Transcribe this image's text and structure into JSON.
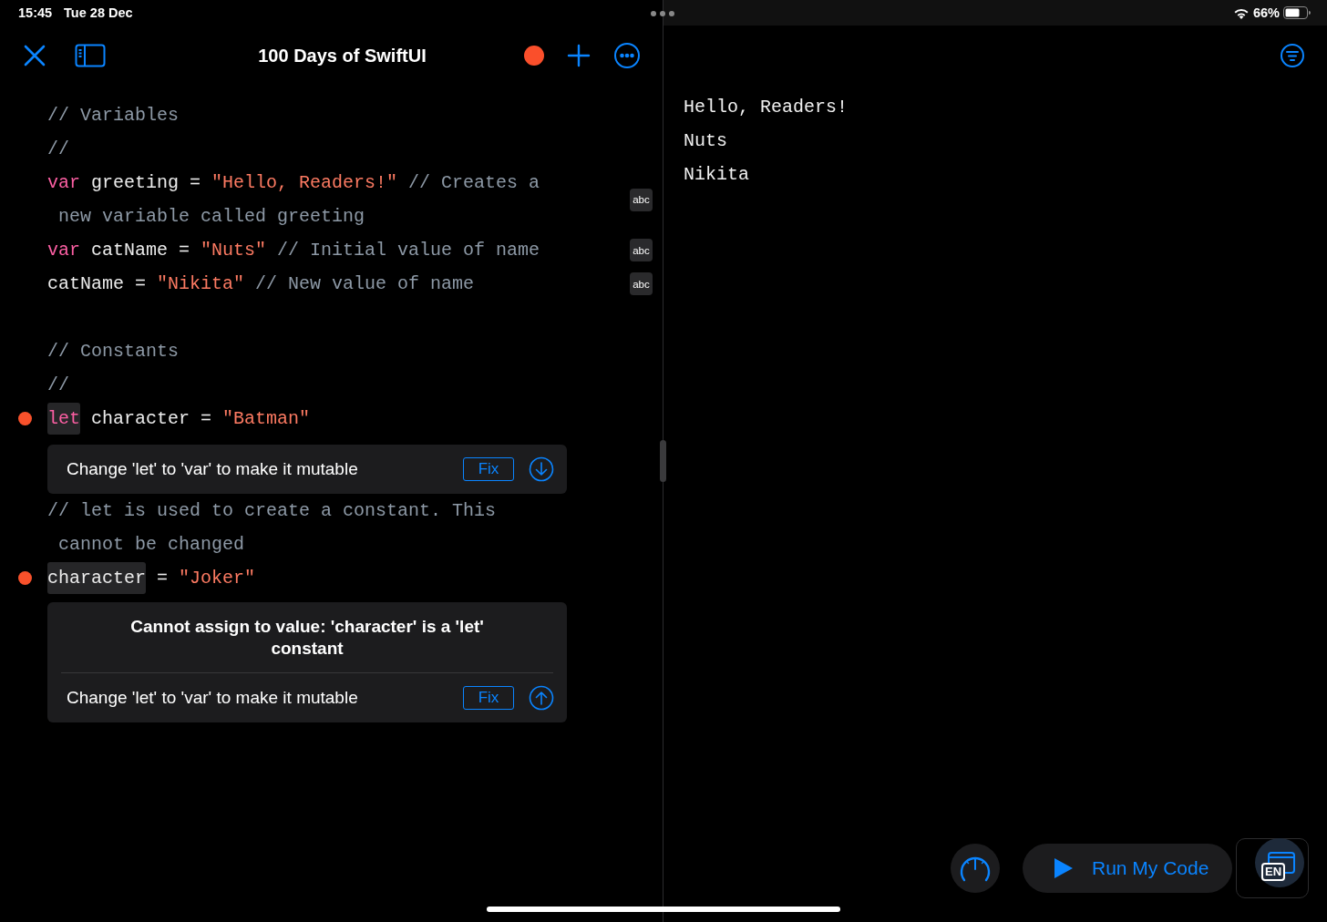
{
  "status_bar": {
    "time": "15:45",
    "date": "Tue 28 Dec",
    "battery": "66%"
  },
  "toolbar": {
    "title": "100 Days of SwiftUI",
    "recording": true
  },
  "code": [
    {
      "kind": "statement",
      "error": false,
      "lines": [
        [
          {
            "kind": "comment",
            "text": "// Variables"
          }
        ]
      ]
    },
    {
      "kind": "statement",
      "error": false,
      "lines": [
        [
          {
            "kind": "comment",
            "text": "//"
          }
        ]
      ]
    },
    {
      "kind": "statement",
      "error": false,
      "badge": "abc",
      "lines": [
        [
          {
            "kind": "keyword",
            "text": "var"
          },
          {
            "kind": "plain",
            "text": " greeting = "
          },
          {
            "kind": "string",
            "text": "\"Hello, Readers!\""
          },
          {
            "kind": "comment",
            "text": " // Creates a"
          }
        ],
        [
          {
            "kind": "comment",
            "text": " new variable called greeting"
          }
        ]
      ]
    },
    {
      "kind": "statement",
      "error": false,
      "badge": "abc",
      "lines": [
        [
          {
            "kind": "keyword",
            "text": "var"
          },
          {
            "kind": "plain",
            "text": " catName = "
          },
          {
            "kind": "string",
            "text": "\"Nuts\""
          },
          {
            "kind": "comment",
            "text": " // Initial value of name"
          }
        ]
      ]
    },
    {
      "kind": "statement",
      "error": false,
      "badge": "abc",
      "lines": [
        [
          {
            "kind": "plain",
            "text": "catName = "
          },
          {
            "kind": "string",
            "text": "\"Nikita\""
          },
          {
            "kind": "comment",
            "text": " // New value of name"
          }
        ]
      ]
    },
    {
      "kind": "blank"
    },
    {
      "kind": "statement",
      "error": false,
      "lines": [
        [
          {
            "kind": "comment",
            "text": "// Constants"
          }
        ]
      ]
    },
    {
      "kind": "statement",
      "error": false,
      "lines": [
        [
          {
            "kind": "comment",
            "text": "//"
          }
        ]
      ]
    },
    {
      "kind": "statement",
      "error": true,
      "lines": [
        [
          {
            "kind": "keyword",
            "text": "let",
            "highlighted": true
          },
          {
            "kind": "plain",
            "text": " character = "
          },
          {
            "kind": "string",
            "text": "\"Batman\""
          }
        ]
      ]
    },
    {
      "kind": "diagnostic",
      "fix_text": "Change 'let' to 'var' to make it mutable",
      "fix_button": "Fix",
      "points_up": false
    },
    {
      "kind": "statement",
      "error": false,
      "lines": [
        [
          {
            "kind": "comment",
            "text": "// let is used to create a constant. This"
          }
        ],
        [
          {
            "kind": "comment",
            "text": " cannot be changed"
          }
        ]
      ]
    },
    {
      "kind": "statement",
      "error": true,
      "lines": [
        [
          {
            "kind": "plain",
            "text": "character",
            "highlighted": true
          },
          {
            "kind": "plain",
            "text": " = "
          },
          {
            "kind": "string",
            "text": "\"Joker\""
          }
        ]
      ]
    },
    {
      "kind": "diagnostic",
      "message": "Cannot assign to value: 'character' is a 'let' constant",
      "fix_text": "Change 'let' to 'var' to make it mutable",
      "fix_button": "Fix",
      "points_up": true
    }
  ],
  "output": [
    "Hello, Readers!",
    "Nuts",
    "Nikita"
  ],
  "run_button": {
    "label": "Run My Code"
  },
  "keyboard_button": {
    "label": "EN"
  }
}
